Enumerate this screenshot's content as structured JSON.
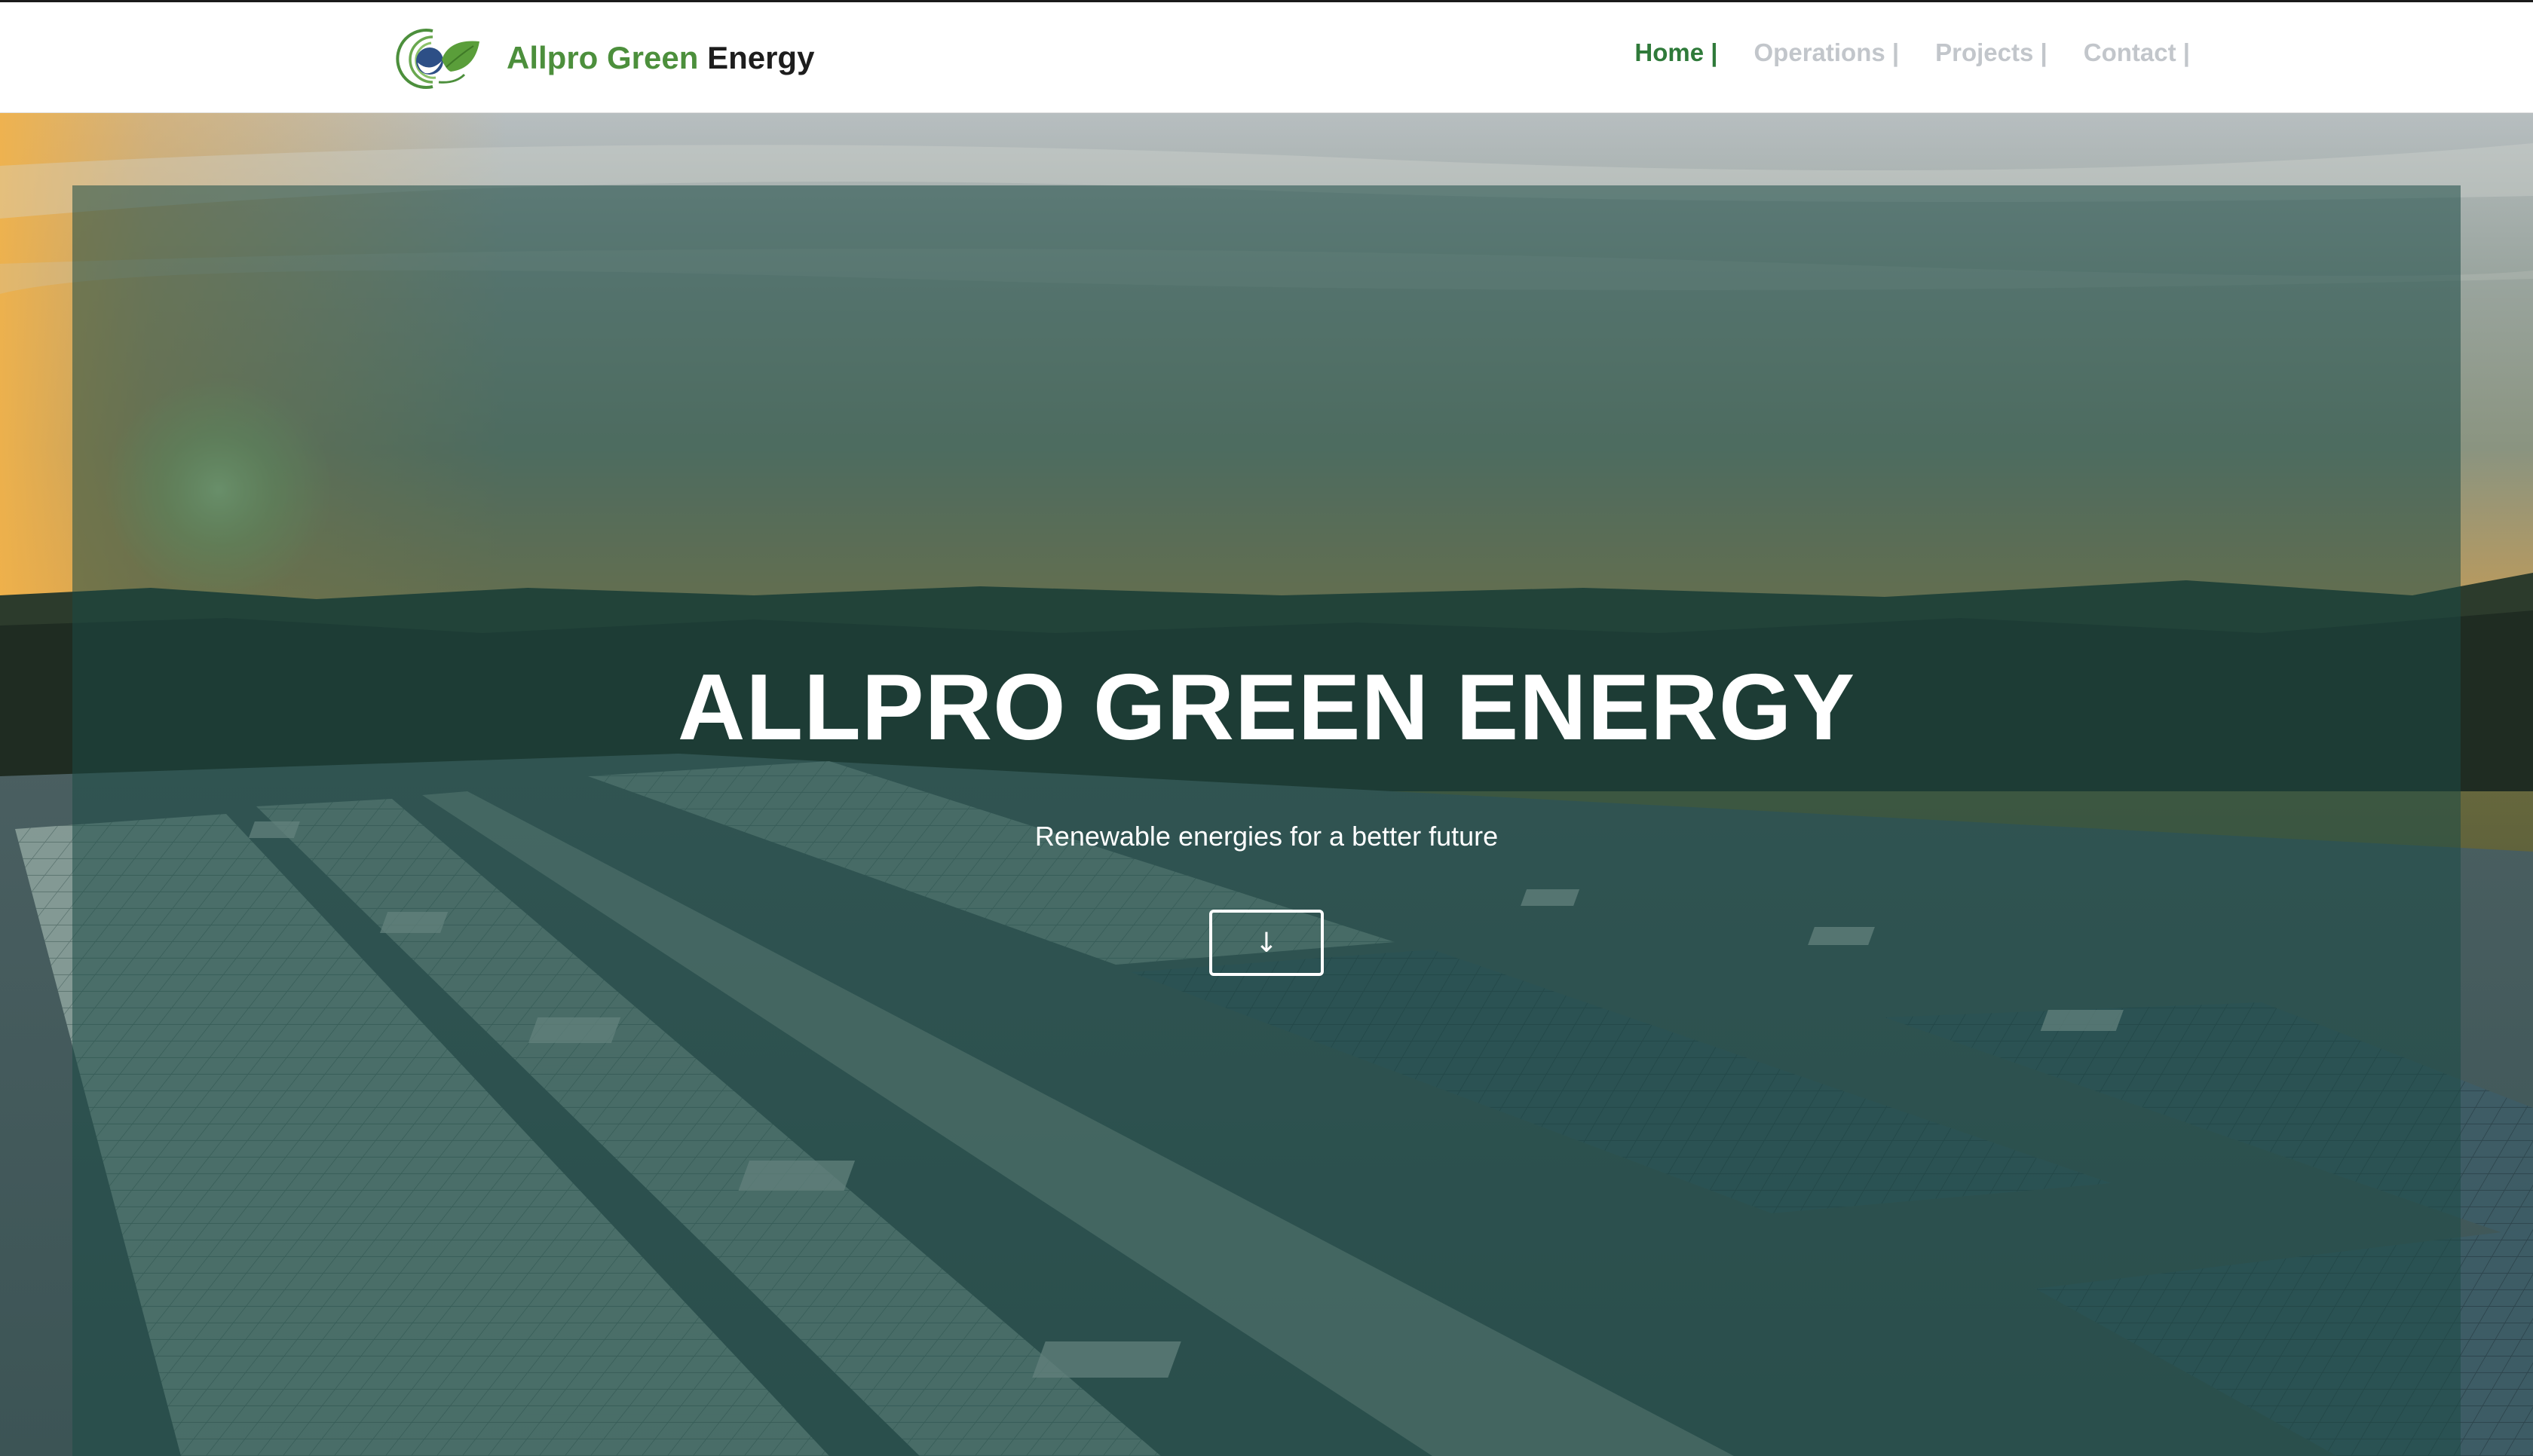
{
  "brand": {
    "name_green": "Allpro Green",
    "name_dark": "Energy"
  },
  "nav": {
    "items": [
      {
        "label": "Home |",
        "active": true
      },
      {
        "label": "Operations |",
        "active": false
      },
      {
        "label": "Projects |",
        "active": false
      },
      {
        "label": "Contact |",
        "active": false
      }
    ]
  },
  "hero": {
    "title": "ALLPRO GREEN ENERGY",
    "subtitle": "Renewable energies for a better future",
    "scroll_button_icon": "arrow-down-icon",
    "scroll_button_glyph": "↓"
  },
  "colors": {
    "brand_green": "#4c8f3c",
    "nav_active": "#2f7a3a",
    "nav_inactive": "#c2c6cb",
    "overlay": "#1c4a46"
  }
}
